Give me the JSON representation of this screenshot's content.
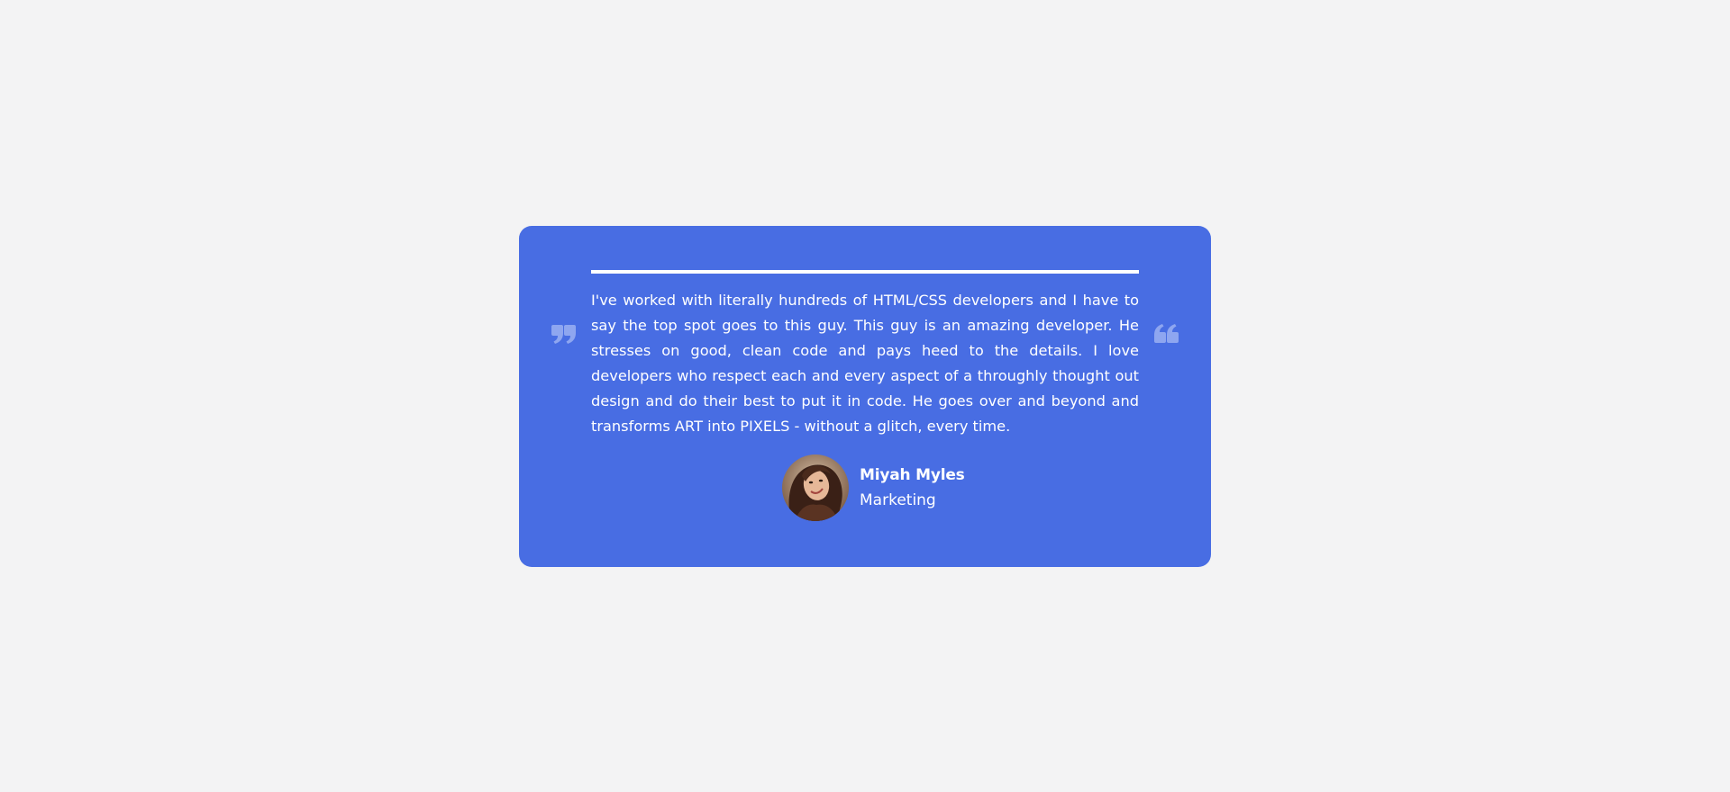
{
  "testimonial": {
    "quote": "I've worked with literally hundreds of HTML/CSS developers and I have to say the top spot goes to this guy. This guy is an amazing developer. He stresses on good, clean code and pays heed to the details. I love developers who respect each and every aspect of a throughly thought out design and do their best to put it in code. He goes over and beyond and transforms ART into PIXELS - without a glitch, every time.",
    "author": {
      "name": "Miyah Myles",
      "role": "Marketing"
    },
    "icons": {
      "left": "quote-left-icon",
      "right": "quote-right-icon"
    }
  },
  "colors": {
    "page_background": "#f3f3f4",
    "card_background": "#486de3",
    "text": "#ffffff",
    "quote_icon": "#8ea6f0"
  }
}
